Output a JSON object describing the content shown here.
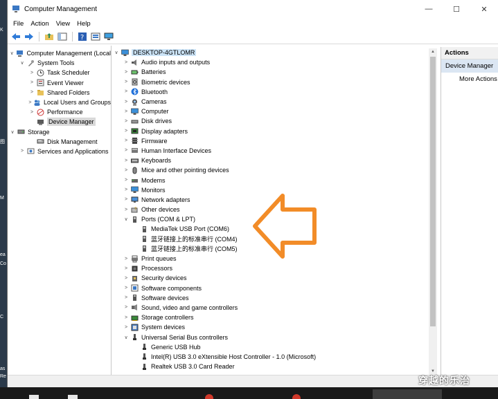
{
  "window": {
    "title": "Computer Management",
    "min": "—",
    "max": "☐",
    "close": "✕"
  },
  "menu": [
    "File",
    "Action",
    "View",
    "Help"
  ],
  "tree": [
    {
      "label": "Computer Management (Local",
      "level": 0,
      "exp": "∨",
      "icon": "computer-management-icon"
    },
    {
      "label": "System Tools",
      "level": 1,
      "exp": "∨",
      "icon": "tools-icon"
    },
    {
      "label": "Task Scheduler",
      "level": 2,
      "exp": ">",
      "icon": "clock-icon"
    },
    {
      "label": "Event Viewer",
      "level": 2,
      "exp": ">",
      "icon": "event-viewer-icon"
    },
    {
      "label": "Shared Folders",
      "level": 2,
      "exp": ">",
      "icon": "shared-folder-icon"
    },
    {
      "label": "Local Users and Groups",
      "level": 2,
      "exp": ">",
      "icon": "users-icon"
    },
    {
      "label": "Performance",
      "level": 2,
      "exp": ">",
      "icon": "performance-icon"
    },
    {
      "label": "Device Manager",
      "level": 2,
      "exp": "",
      "icon": "device-manager-icon",
      "selected": true
    },
    {
      "label": "Storage",
      "level": 0,
      "exp": "∨",
      "icon": "storage-icon"
    },
    {
      "label": "Disk Management",
      "level": 2,
      "exp": "",
      "icon": "disk-icon"
    },
    {
      "label": "Services and Applications",
      "level": 1,
      "exp": ">",
      "icon": "services-icon"
    }
  ],
  "devices": {
    "root": "DESKTOP-4GTLOMR",
    "rows": [
      {
        "label": "Audio inputs and outputs",
        "level": 1,
        "exp": ">",
        "icon": "speaker-icon"
      },
      {
        "label": "Batteries",
        "level": 1,
        "exp": ">",
        "icon": "battery-icon"
      },
      {
        "label": "Biometric devices",
        "level": 1,
        "exp": ">",
        "icon": "biometric-icon"
      },
      {
        "label": "Bluetooth",
        "level": 1,
        "exp": ">",
        "icon": "bluetooth-icon"
      },
      {
        "label": "Cameras",
        "level": 1,
        "exp": ">",
        "icon": "camera-icon"
      },
      {
        "label": "Computer",
        "level": 1,
        "exp": ">",
        "icon": "monitor-icon"
      },
      {
        "label": "Disk drives",
        "level": 1,
        "exp": ">",
        "icon": "disk-drive-icon"
      },
      {
        "label": "Display adapters",
        "level": 1,
        "exp": ">",
        "icon": "display-adapter-icon"
      },
      {
        "label": "Firmware",
        "level": 1,
        "exp": ">",
        "icon": "firmware-icon"
      },
      {
        "label": "Human Interface Devices",
        "level": 1,
        "exp": ">",
        "icon": "hid-icon"
      },
      {
        "label": "Keyboards",
        "level": 1,
        "exp": ">",
        "icon": "keyboard-icon"
      },
      {
        "label": "Mice and other pointing devices",
        "level": 1,
        "exp": ">",
        "icon": "mouse-icon"
      },
      {
        "label": "Modems",
        "level": 1,
        "exp": ">",
        "icon": "modem-icon"
      },
      {
        "label": "Monitors",
        "level": 1,
        "exp": ">",
        "icon": "monitor-icon"
      },
      {
        "label": "Network adapters",
        "level": 1,
        "exp": ">",
        "icon": "network-icon"
      },
      {
        "label": "Other devices",
        "level": 1,
        "exp": ">",
        "icon": "other-devices-icon"
      },
      {
        "label": "Ports (COM & LPT)",
        "level": 1,
        "exp": "∨",
        "icon": "port-icon"
      },
      {
        "label": "MediaTek USB Port (COM6)",
        "level": 2,
        "exp": "",
        "icon": "port-icon"
      },
      {
        "label": "蓝牙链接上的标准串行 (COM4)",
        "level": 2,
        "exp": "",
        "icon": "port-icon"
      },
      {
        "label": "蓝牙链接上的标准串行 (COM5)",
        "level": 2,
        "exp": "",
        "icon": "port-icon"
      },
      {
        "label": "Print queues",
        "level": 1,
        "exp": ">",
        "icon": "printer-icon"
      },
      {
        "label": "Processors",
        "level": 1,
        "exp": ">",
        "icon": "processor-icon"
      },
      {
        "label": "Security devices",
        "level": 1,
        "exp": ">",
        "icon": "security-icon"
      },
      {
        "label": "Software components",
        "level": 1,
        "exp": ">",
        "icon": "software-component-icon"
      },
      {
        "label": "Software devices",
        "level": 1,
        "exp": ">",
        "icon": "software-device-icon"
      },
      {
        "label": "Sound, video and game controllers",
        "level": 1,
        "exp": ">",
        "icon": "sound-icon"
      },
      {
        "label": "Storage controllers",
        "level": 1,
        "exp": ">",
        "icon": "storage-controller-icon"
      },
      {
        "label": "System devices",
        "level": 1,
        "exp": ">",
        "icon": "system-device-icon"
      },
      {
        "label": "Universal Serial Bus controllers",
        "level": 1,
        "exp": "∨",
        "icon": "usb-icon"
      },
      {
        "label": "Generic USB Hub",
        "level": 2,
        "exp": "",
        "icon": "usb-icon"
      },
      {
        "label": "Intel(R) USB 3.0 eXtensible Host Controller - 1.0 (Microsoft)",
        "level": 2,
        "exp": "",
        "icon": "usb-icon"
      },
      {
        "label": "Realtek USB 3.0 Card Reader",
        "level": 2,
        "exp": "",
        "icon": "usb-icon"
      }
    ]
  },
  "actions": {
    "header": "Actions",
    "selected": "Device Manager",
    "more": "More Actions"
  },
  "watermark": "穿越的乐治",
  "colors": {
    "accent": "#cce4f7",
    "arrow": "#f28c28",
    "selection": "#d9d9d9"
  }
}
